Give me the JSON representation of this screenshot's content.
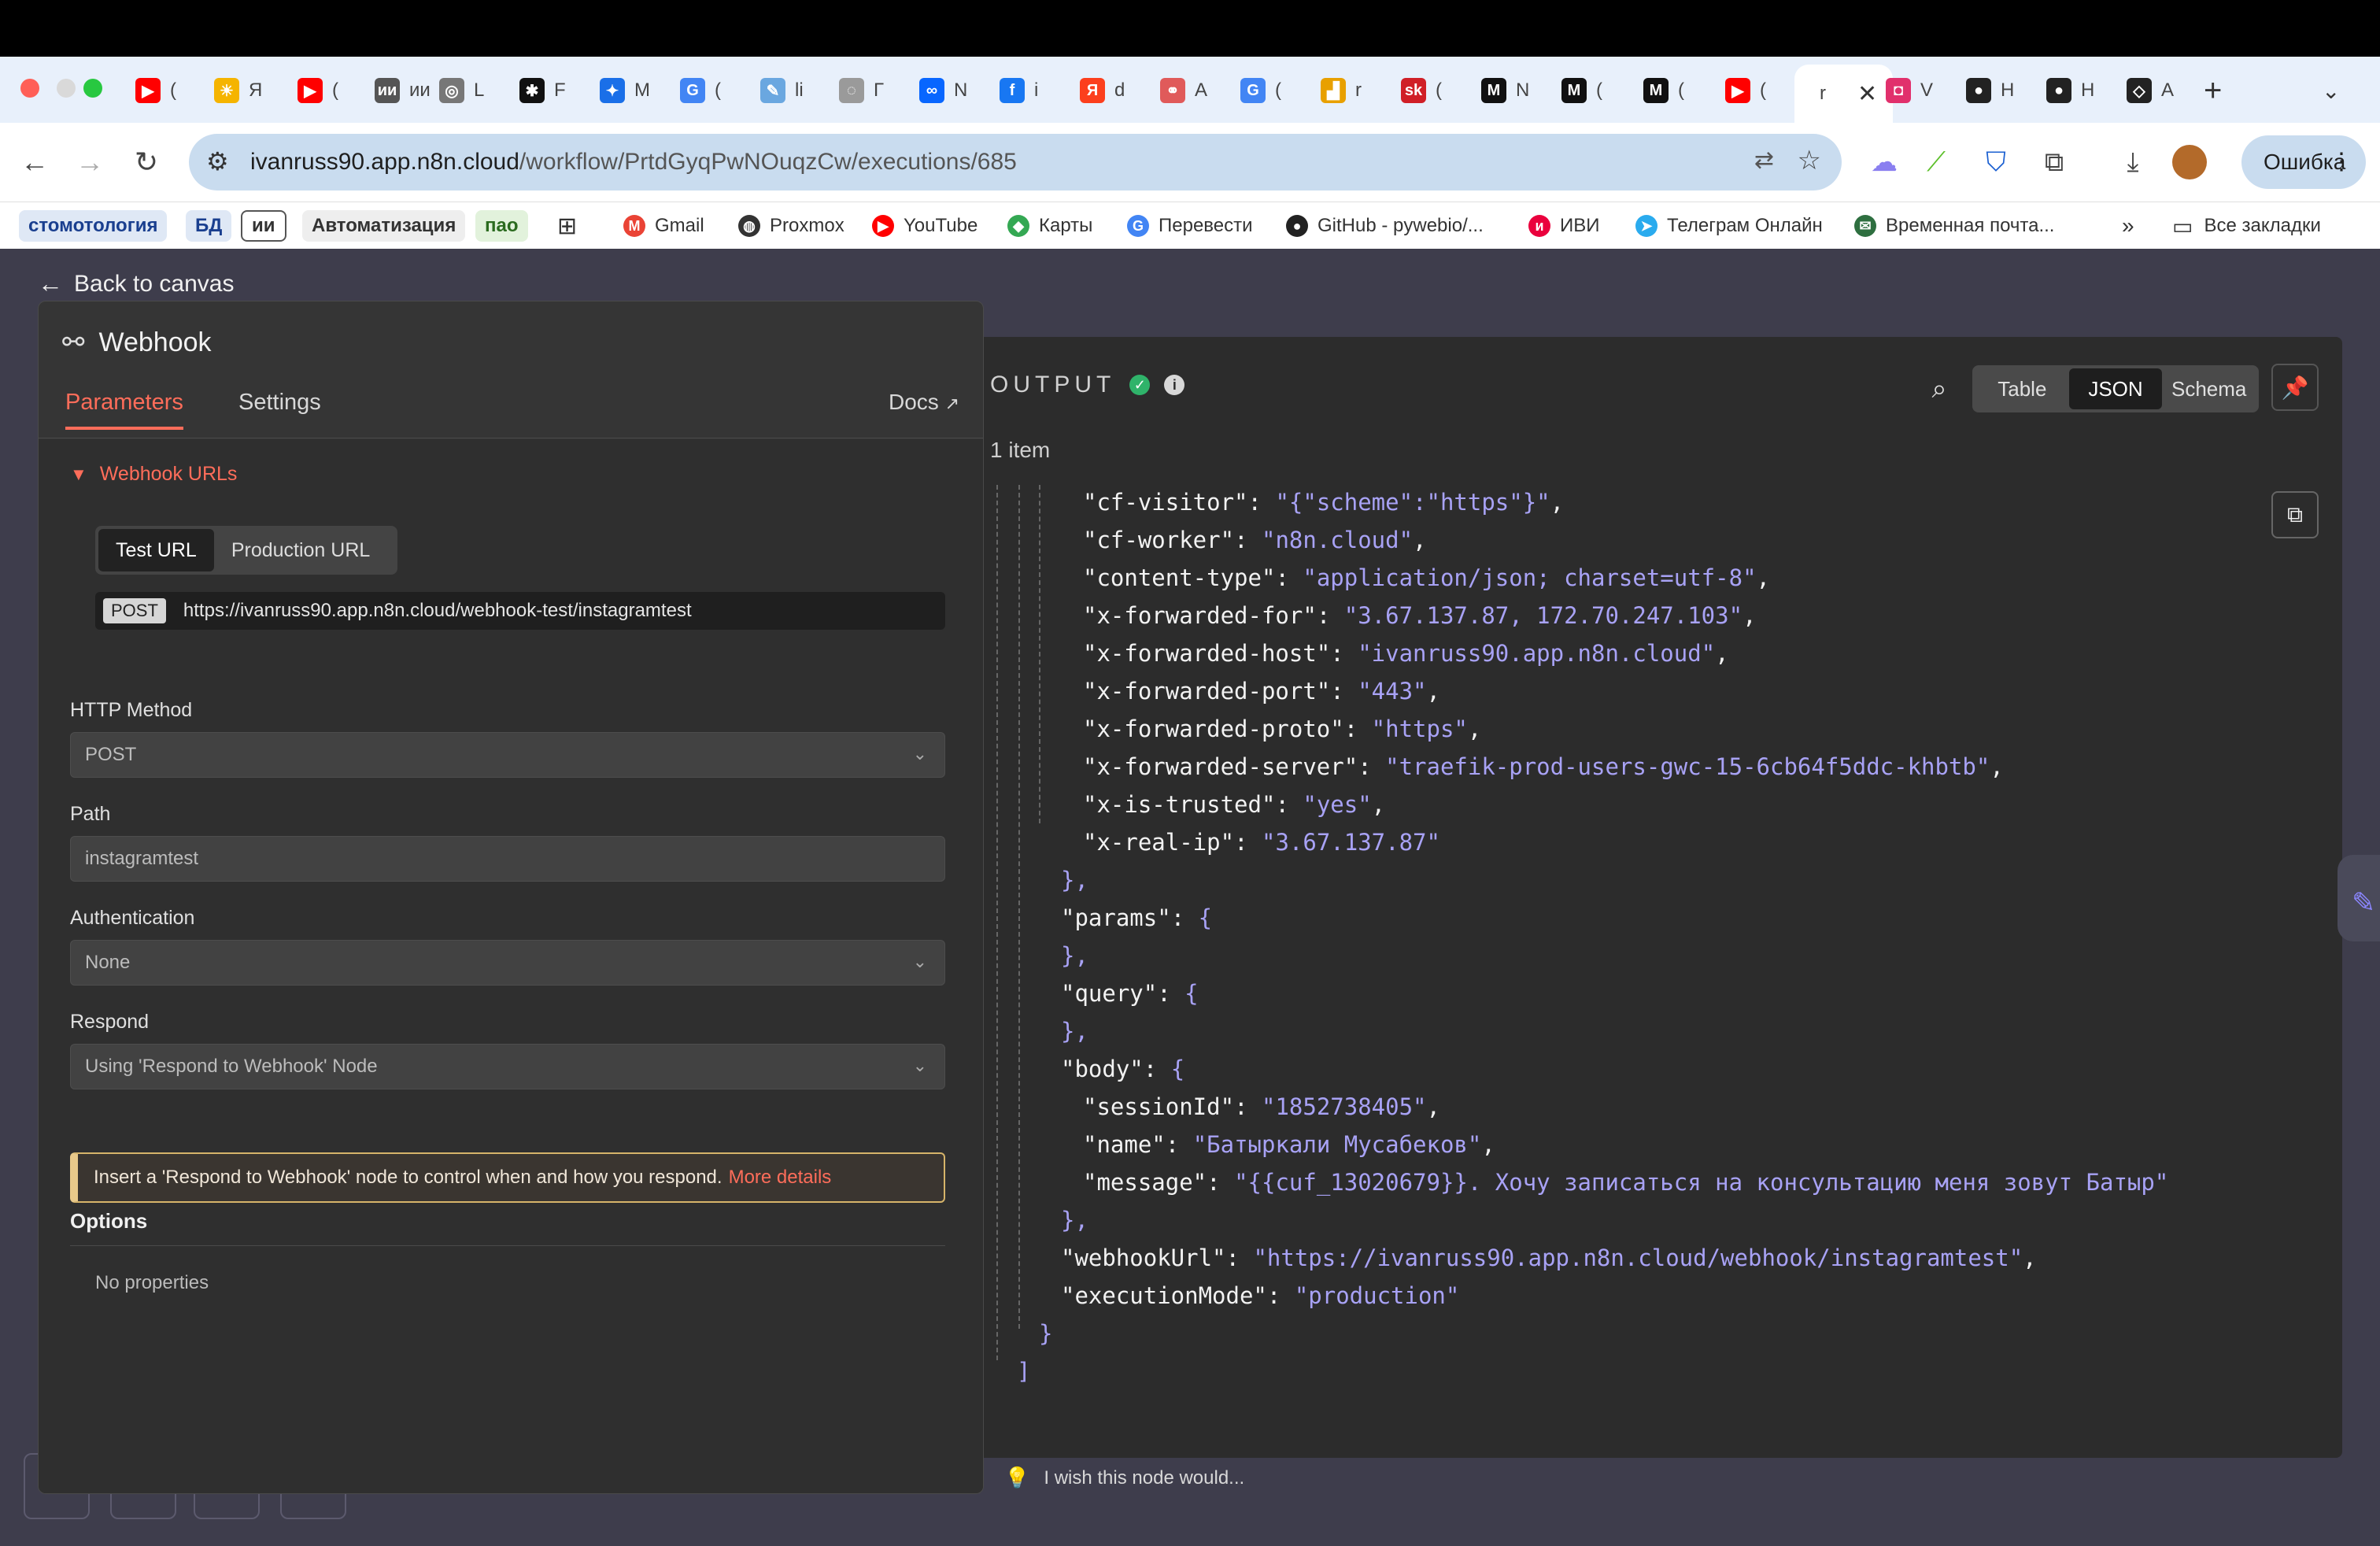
{
  "browser": {
    "tabs": [
      {
        "label": "(",
        "icon": "youtube-icon",
        "color": "#ff0000",
        "glyph": "▶"
      },
      {
        "label": "Я",
        "icon": "sun-icon",
        "color": "#f5b400",
        "glyph": "☀"
      },
      {
        "label": "(",
        "icon": "youtube-icon",
        "color": "#ff0000",
        "glyph": "▶"
      },
      {
        "label": "ии",
        "icon": "ai-icon",
        "color": "#555555",
        "glyph": "ии"
      },
      {
        "label": "L",
        "icon": "circle-icon",
        "color": "#777777",
        "glyph": "◎"
      },
      {
        "label": "F",
        "icon": "perplexity-icon",
        "color": "#111111",
        "glyph": "✱"
      },
      {
        "label": "M",
        "icon": "butterfly-icon",
        "color": "#1a6fe8",
        "glyph": "✦"
      },
      {
        "label": "(",
        "icon": "google-icon",
        "color": "#4285f4",
        "glyph": "G"
      },
      {
        "label": "li",
        "icon": "pen-icon",
        "color": "#6aa7e0",
        "glyph": "✎"
      },
      {
        "label": "Г",
        "icon": "chat-icon",
        "color": "#9a9a9a",
        "glyph": "◌"
      },
      {
        "label": "N",
        "icon": "meta-icon",
        "color": "#0866ff",
        "glyph": "∞"
      },
      {
        "label": "i",
        "icon": "facebook-icon",
        "color": "#1877f2",
        "glyph": "f"
      },
      {
        "label": "d",
        "icon": "yandex-icon",
        "color": "#fc3f1d",
        "glyph": "Я"
      },
      {
        "label": "A",
        "icon": "link-icon",
        "color": "#e05a5a",
        "glyph": "⚭"
      },
      {
        "label": "(",
        "icon": "google-icon",
        "color": "#4285f4",
        "glyph": "G"
      },
      {
        "label": "r",
        "icon": "chart-icon",
        "color": "#e8a000",
        "glyph": "▟"
      },
      {
        "label": "(",
        "icon": "sk-icon",
        "color": "#d01f27",
        "glyph": "sk"
      },
      {
        "label": "N",
        "icon": "m-icon",
        "color": "#111111",
        "glyph": "M"
      },
      {
        "label": "(",
        "icon": "m-icon",
        "color": "#111111",
        "glyph": "M"
      },
      {
        "label": "(",
        "icon": "m-icon",
        "color": "#111111",
        "glyph": "M"
      },
      {
        "label": "(",
        "icon": "youtube-icon",
        "color": "#ff0000",
        "glyph": "▶"
      },
      {
        "label": "r",
        "icon": "n8n-icon",
        "color": "#ffffff",
        "glyph": "",
        "active": true
      },
      {
        "label": "V",
        "icon": "instagram-icon",
        "color": "#e1306c",
        "glyph": "◘"
      },
      {
        "label": "H",
        "icon": "github-icon",
        "color": "#222222",
        "glyph": "●"
      },
      {
        "label": "H",
        "icon": "github-icon",
        "color": "#222222",
        "glyph": "●"
      },
      {
        "label": "A",
        "icon": "codepen-icon",
        "color": "#222222",
        "glyph": "◇"
      }
    ],
    "url_host": "ivanruss90.app.n8n.cloud",
    "url_path": "/workflow/PrtdGyqPwNOuqzCw/executions/685",
    "profile_status": "Ошибка",
    "bookmarks": [
      {
        "label": "стомотология",
        "chip": true
      },
      {
        "label": "БД",
        "chip": true
      },
      {
        "label": "ии",
        "chip": true
      },
      {
        "label": "Автоматизация",
        "chip": true
      },
      {
        "label": "пао",
        "chip": true
      },
      {
        "label": "Gmail",
        "icon": "gmail-icon",
        "color": "#ea4335",
        "glyph": "M"
      },
      {
        "label": "Proxmox",
        "icon": "globe-icon",
        "color": "#333333",
        "glyph": "◍"
      },
      {
        "label": "YouTube",
        "icon": "youtube-icon",
        "color": "#ff0000",
        "glyph": "▶"
      },
      {
        "label": "Карты",
        "icon": "maps-icon",
        "color": "#34a853",
        "glyph": "◆"
      },
      {
        "label": "Перевести",
        "icon": "translate-icon",
        "color": "#4285f4",
        "glyph": "G"
      },
      {
        "label": "GitHub - pywebio/...",
        "icon": "github-icon",
        "color": "#222222",
        "glyph": "●"
      },
      {
        "label": "ИВИ",
        "icon": "ivi-icon",
        "color": "#ea003d",
        "glyph": "и"
      },
      {
        "label": "Телеграм Онлайн",
        "icon": "telegram-icon",
        "color": "#2aabee",
        "glyph": "➤"
      },
      {
        "label": "Временная почта...",
        "icon": "mail-icon",
        "color": "#2e6f40",
        "glyph": "✉"
      }
    ],
    "bookmarks_all": "Все закладки"
  },
  "app": {
    "back_label": "Back to canvas",
    "node_title": "Webhook",
    "tabs": {
      "parameters": "Parameters",
      "settings": "Settings",
      "docs": "Docs"
    },
    "webhook_urls_title": "Webhook URLs",
    "url_toggle": {
      "test": "Test URL",
      "production": "Production URL"
    },
    "url_method": "POST",
    "url_value": "https://ivanruss90.app.n8n.cloud/webhook-test/instagramtest",
    "fields": {
      "http_method_label": "HTTP Method",
      "http_method_value": "POST",
      "path_label": "Path",
      "path_value": "instagramtest",
      "auth_label": "Authentication",
      "auth_value": "None",
      "respond_label": "Respond",
      "respond_value": "Using 'Respond to Webhook' Node"
    },
    "notice": "Insert a 'Respond to Webhook' node to control when and how you respond.",
    "notice_link": "More details",
    "options_label": "Options",
    "no_properties": "No properties",
    "output_title": "OUTPUT",
    "item_count": "1 item",
    "view_toggle": [
      "Table",
      "JSON",
      "Schema"
    ],
    "view_selected": "JSON",
    "wish": "I wish this node would...",
    "json_lines": [
      {
        "indent": 1,
        "k": "\"cf-visitor\"",
        "v": "\"{\"scheme\":\"https\"}\"",
        "tail": ","
      },
      {
        "indent": 1,
        "k": "\"cf-worker\"",
        "v": "\"n8n.cloud\"",
        "tail": ","
      },
      {
        "indent": 1,
        "k": "\"content-type\"",
        "v": "\"application/json; charset=utf-8\"",
        "tail": ","
      },
      {
        "indent": 1,
        "k": "\"x-forwarded-for\"",
        "v": "\"3.67.137.87, 172.70.247.103\"",
        "tail": ","
      },
      {
        "indent": 1,
        "k": "\"x-forwarded-host\"",
        "v": "\"ivanruss90.app.n8n.cloud\"",
        "tail": ","
      },
      {
        "indent": 1,
        "k": "\"x-forwarded-port\"",
        "v": "\"443\"",
        "tail": ","
      },
      {
        "indent": 1,
        "k": "\"x-forwarded-proto\"",
        "v": "\"https\"",
        "tail": ","
      },
      {
        "indent": 1,
        "k": "\"x-forwarded-server\"",
        "v": "\"traefik-prod-users-gwc-15-6cb64f5ddc-khbtb\"",
        "tail": ","
      },
      {
        "indent": 1,
        "k": "\"x-is-trusted\"",
        "v": "\"yes\"",
        "tail": ","
      },
      {
        "indent": 1,
        "k": "\"x-real-ip\"",
        "v": "\"3.67.137.87\"",
        "tail": ""
      },
      {
        "indent": 0,
        "k": "",
        "v": "",
        "tail": "},",
        "punct": true
      },
      {
        "indent": 0,
        "k": "\"params\"",
        "v": "{",
        "tail": "",
        "obj": true
      },
      {
        "indent": 0,
        "k": "",
        "v": "",
        "tail": "},",
        "punct": true
      },
      {
        "indent": 0,
        "k": "\"query\"",
        "v": "{",
        "tail": "",
        "obj": true
      },
      {
        "indent": 0,
        "k": "",
        "v": "",
        "tail": "},",
        "punct": true
      },
      {
        "indent": 0,
        "k": "\"body\"",
        "v": "{",
        "tail": "",
        "obj": true
      },
      {
        "indent": 1,
        "k": "\"sessionId\"",
        "v": "\"1852738405\"",
        "tail": ","
      },
      {
        "indent": 1,
        "k": "\"name\"",
        "v": "\"Батыркали Мусабеков\"",
        "tail": ","
      },
      {
        "indent": 1,
        "k": "\"message\"",
        "v": "\"{{cuf_13020679}}. Хочу записаться на консультацию меня зовут Батыр\"",
        "tail": ""
      },
      {
        "indent": 0,
        "k": "",
        "v": "",
        "tail": "},",
        "punct": true
      },
      {
        "indent": 0,
        "k": "\"webhookUrl\"",
        "v": "\"https://ivanruss90.app.n8n.cloud/webhook/instagramtest\"",
        "tail": ","
      },
      {
        "indent": 0,
        "k": "\"executionMode\"",
        "v": "\"production\"",
        "tail": ""
      },
      {
        "indent": -1,
        "k": "",
        "v": "",
        "tail": "}",
        "punct": true
      },
      {
        "indent": -2,
        "k": "",
        "v": "",
        "tail": "]",
        "punct": true
      }
    ]
  }
}
